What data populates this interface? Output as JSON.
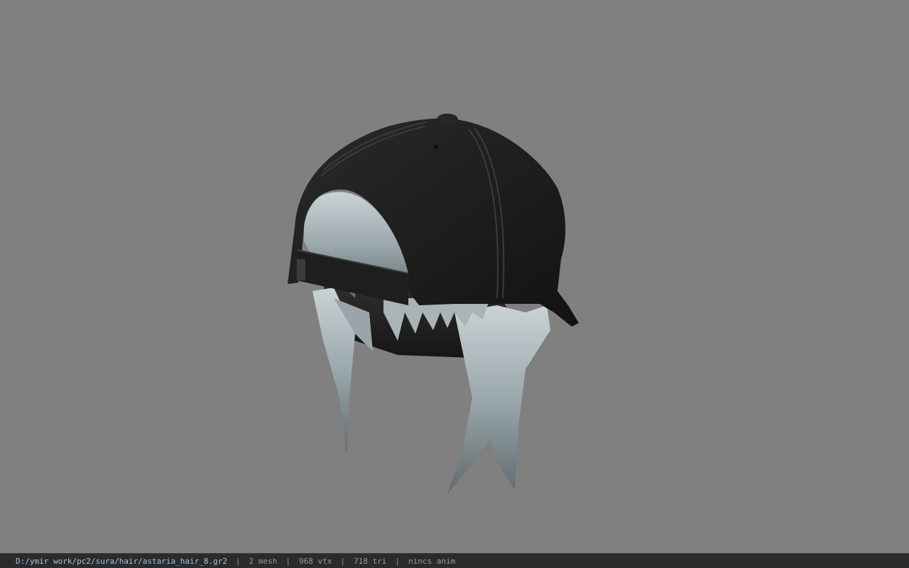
{
  "viewer": {
    "background_color": "#808080",
    "model": {
      "icon": "cap-with-hair-model"
    }
  },
  "status_bar": {
    "path": "D:/ymir work/pc2/sura/hair/astaria_hair_8.gr2",
    "separator": "|",
    "mesh": "2 mesh",
    "vertices": "968 vtx",
    "triangles": "718 tri",
    "anim": "nincs anim",
    "path_color": "#9fc6e6",
    "bg_color": "#2b2b2b"
  }
}
